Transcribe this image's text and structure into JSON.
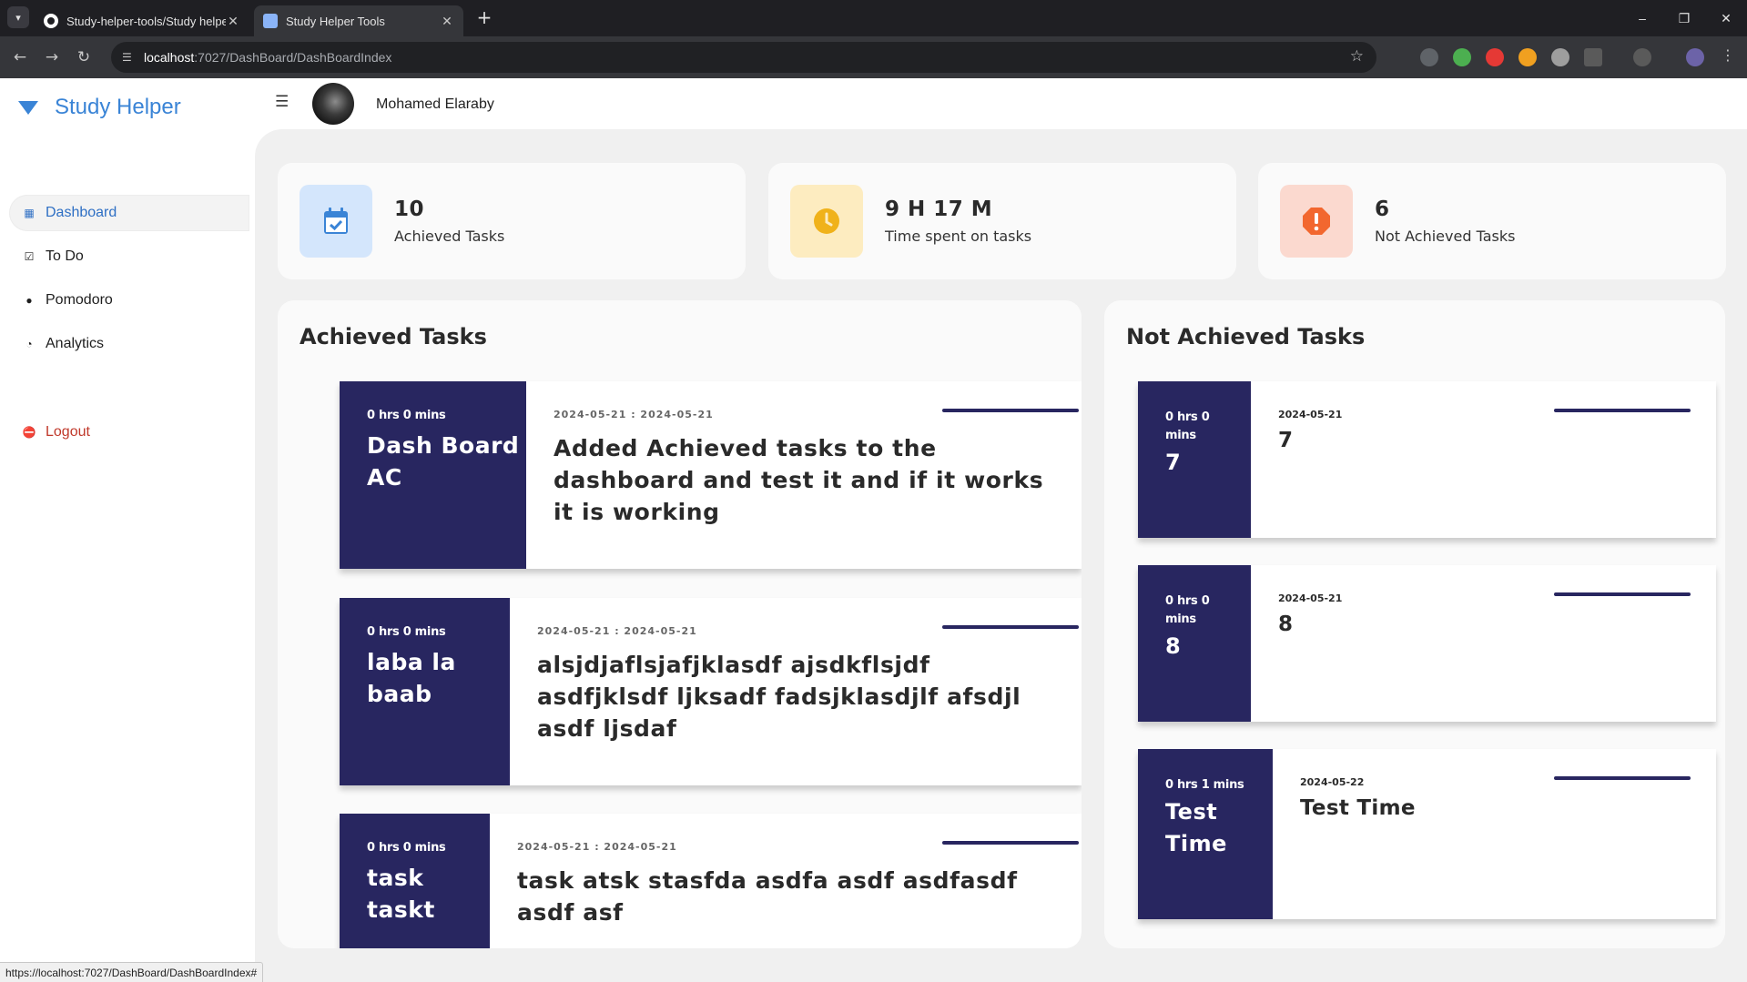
{
  "browser": {
    "tabs": [
      {
        "title": "Study-helper-tools/Study helper",
        "active": false
      },
      {
        "title": "Study Helper Tools",
        "active": true
      }
    ],
    "url_host": "localhost",
    "url_path": ":7027/DashBoard/DashBoardIndex",
    "status_url": "https://localhost:7027/DashBoard/DashBoardIndex#"
  },
  "brand": {
    "name": "Study Helper",
    "color": "#3a84d6"
  },
  "sidebar": {
    "items": [
      {
        "label": "Dashboard",
        "icon": "grid-icon",
        "active": true
      },
      {
        "label": "To Do",
        "icon": "checkbox-icon",
        "active": false
      },
      {
        "label": "Pomodoro",
        "icon": "pomodoro-icon",
        "active": false
      },
      {
        "label": "Analytics",
        "icon": "circle-chart-icon",
        "active": false
      }
    ],
    "logout": {
      "label": "Logout",
      "icon": "logout-icon",
      "color": "#c0392b"
    }
  },
  "user": {
    "name": "Mohamed Elaraby"
  },
  "stats": [
    {
      "value": "10",
      "label": "Achieved Tasks",
      "icon": "calendar-check-icon",
      "bg": "#d4e6fc",
      "fg": "#3a84d6"
    },
    {
      "value": "9 H 17 M",
      "label": "Time spent on tasks",
      "icon": "clock-icon",
      "bg": "#fdecc0",
      "fg": "#f0b21a"
    },
    {
      "value": "6",
      "label": "Not Achieved Tasks",
      "icon": "alert-icon",
      "bg": "#fbd9cf",
      "fg": "#f2672f"
    }
  ],
  "achieved": {
    "title": "Achieved Tasks",
    "tasks": [
      {
        "duration": "0 hrs 0 mins",
        "name": "Dash Board AC",
        "dates": "2024-05-21 : 2024-05-21",
        "description": "Added Achieved tasks to the dashboard and test it and if it works it is working"
      },
      {
        "duration": "0 hrs 0 mins",
        "name": "laba la baab",
        "dates": "2024-05-21 : 2024-05-21",
        "description": "alsjdjaflsjafjklasdf ajsdkflsjdf asdfjklsdf ljksadf fadsjklasdjlf afsdjl asdf ljsdaf"
      },
      {
        "duration": "0 hrs 0 mins",
        "name": "task taskt",
        "dates": "2024-05-21 : 2024-05-21",
        "description": "task atsk stasfda asdfa asdf asdfasdf asdf asf"
      }
    ]
  },
  "not_achieved": {
    "title": "Not Achieved Tasks",
    "tasks": [
      {
        "duration": "0 hrs 0 mins",
        "name": "7",
        "date": "2024-05-21",
        "description": "7"
      },
      {
        "duration": "0 hrs 0 mins",
        "name": "8",
        "date": "2024-05-21",
        "description": "8"
      },
      {
        "duration": "0 hrs 1 mins",
        "name": "Test Time",
        "date": "2024-05-22",
        "description": "Test Time"
      }
    ]
  },
  "accent_color": "#282660"
}
